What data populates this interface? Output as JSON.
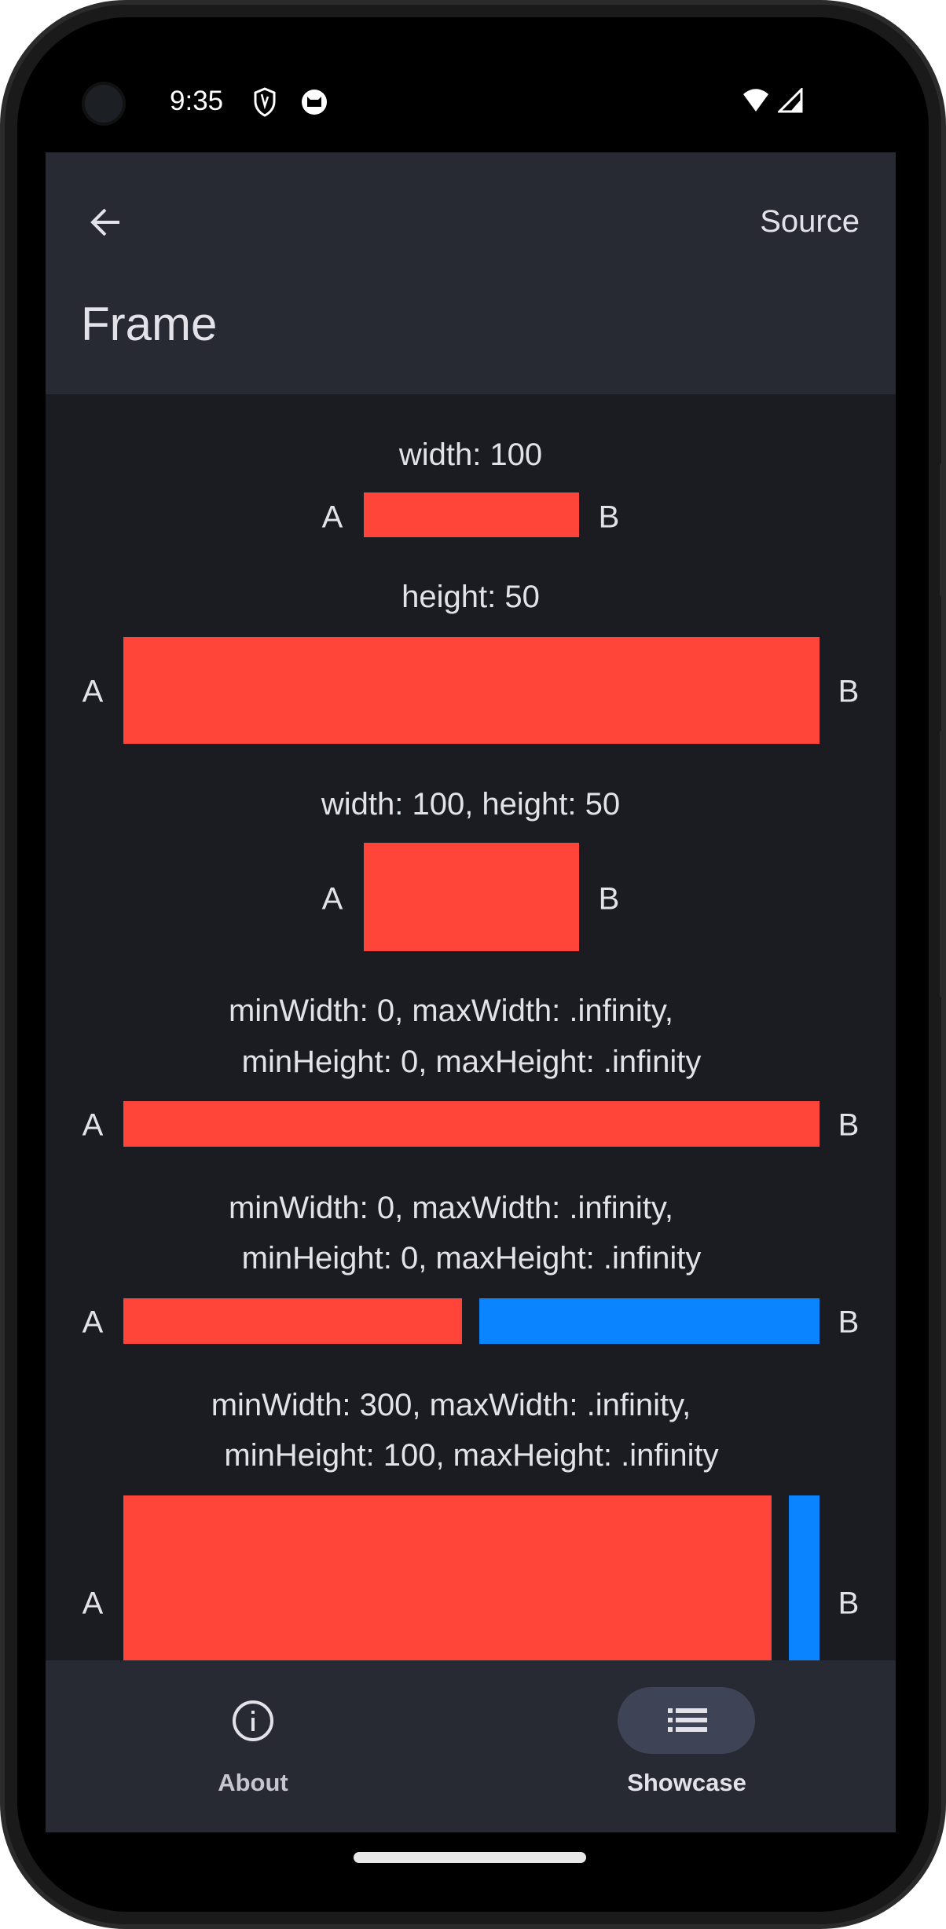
{
  "status_bar": {
    "time": "9:35",
    "icons": [
      "shield-icon",
      "cat-icon",
      "wifi-icon",
      "signal-icon"
    ]
  },
  "app_bar": {
    "back_icon": "arrow-left-icon",
    "source_label": "Source",
    "title": "Frame"
  },
  "colors": {
    "primary_box": "#ff453a",
    "secondary_box": "#0a84ff",
    "app_bar": "#272a33",
    "content_bg": "#1b1c21"
  },
  "examples": [
    {
      "caption": [
        "width: 100"
      ],
      "left": "A",
      "right": "B"
    },
    {
      "caption": [
        "height: 50"
      ],
      "left": "A",
      "right": "B"
    },
    {
      "caption": [
        "width: 100, height: 50"
      ],
      "left": "A",
      "right": "B"
    },
    {
      "caption": [
        "minWidth: 0, maxWidth: .infinity,",
        "minHeight: 0, maxHeight: .infinity"
      ],
      "left": "A",
      "right": "B"
    },
    {
      "caption": [
        "minWidth: 0, maxWidth: .infinity,",
        "minHeight: 0, maxHeight: .infinity"
      ],
      "left": "A",
      "right": "B"
    },
    {
      "caption": [
        "minWidth: 300, maxWidth: .infinity,",
        "minHeight: 100, maxHeight: .infinity"
      ],
      "left": "A",
      "right": "B"
    }
  ],
  "nav": {
    "items": [
      {
        "label": "About",
        "icon": "info-icon",
        "selected": false
      },
      {
        "label": "Showcase",
        "icon": "list-icon",
        "selected": true
      }
    ]
  }
}
